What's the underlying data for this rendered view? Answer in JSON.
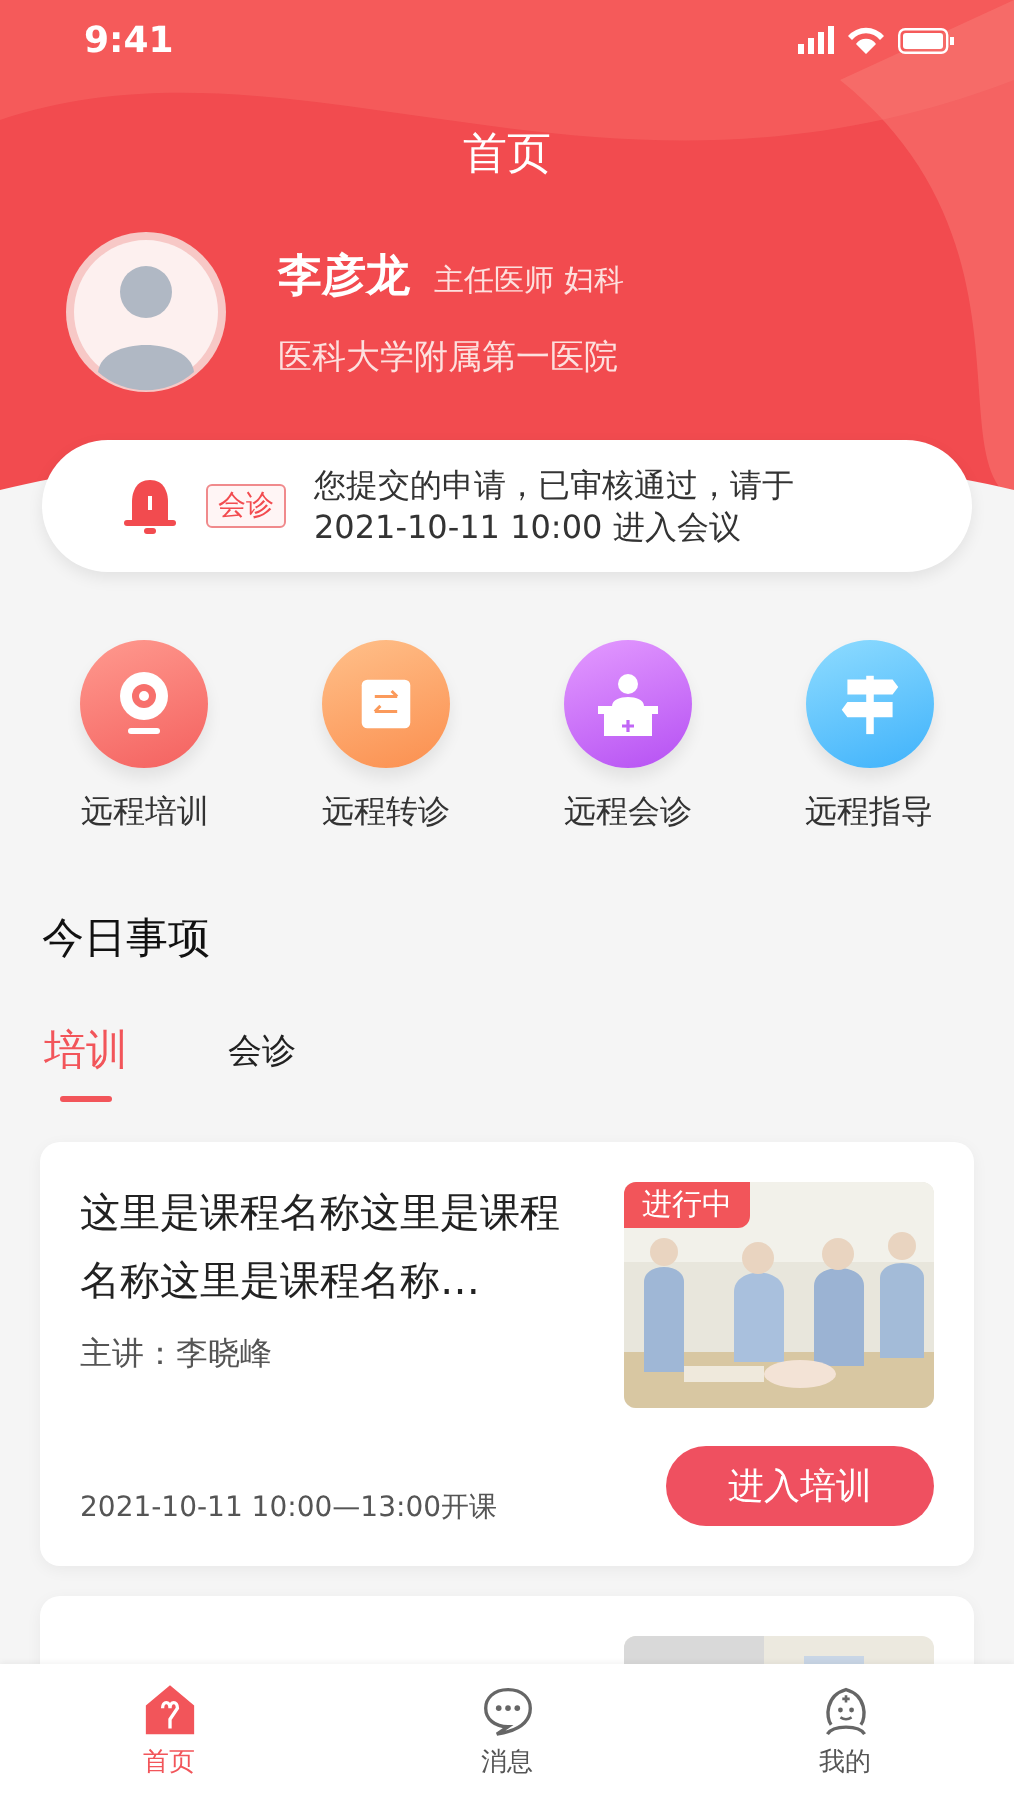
{
  "status_bar": {
    "time": "9:41"
  },
  "header": {
    "title": "首页"
  },
  "profile": {
    "name": "李彦龙",
    "position": "主任医师 妇科",
    "hospital": "医科大学附属第一医院"
  },
  "notice": {
    "tag": "会诊",
    "lines": [
      "您提交的申请，已审核通过，请于",
      "2021-10-11 10:00 进入会议"
    ]
  },
  "services": [
    {
      "label": "远程培训",
      "kind": "camera"
    },
    {
      "label": "远程转诊",
      "kind": "transfer"
    },
    {
      "label": "远程会诊",
      "kind": "consult"
    },
    {
      "label": "远程指导",
      "kind": "guide"
    }
  ],
  "section_title": "今日事项",
  "tabs": [
    {
      "label": "培训",
      "selected": true
    },
    {
      "label": "会诊",
      "selected": false
    }
  ],
  "courses": [
    {
      "kind": "full",
      "title": "这里是课程名称这里是课程名称这里是课程名称…",
      "lecturer": "主讲：李晓峰",
      "time": "2021-10-11 10:00—13:00开课",
      "status": "进行中",
      "button": "进入培训"
    },
    {
      "kind": "clipped"
    }
  ],
  "nav": [
    {
      "label": "首页",
      "kind": "home",
      "selected": true
    },
    {
      "label": "消息",
      "kind": "message",
      "selected": false
    },
    {
      "label": "我的",
      "kind": "profile",
      "selected": false
    }
  ]
}
